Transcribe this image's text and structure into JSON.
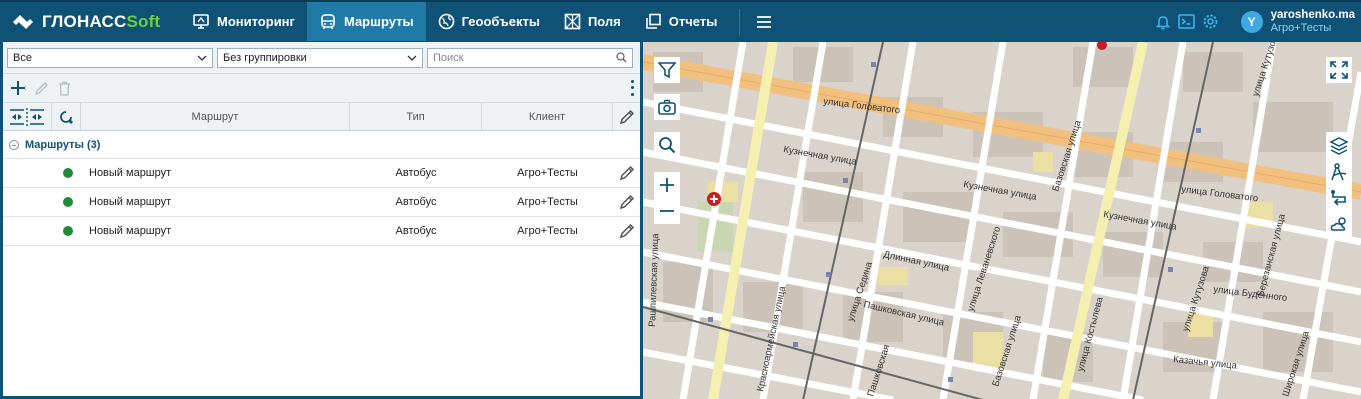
{
  "header": {
    "logo_main": "ГЛОНАСС",
    "logo_soft": "Soft",
    "nav": [
      {
        "label": "Мониторинг",
        "icon": "monitor-icon"
      },
      {
        "label": "Маршруты",
        "icon": "bus-icon",
        "active": true
      },
      {
        "label": "Геообъекты",
        "icon": "globe-icon"
      },
      {
        "label": "Поля",
        "icon": "field-icon"
      },
      {
        "label": "Отчеты",
        "icon": "report-icon"
      }
    ],
    "user": {
      "initial": "Y",
      "name": "yaroshenko.ma",
      "org": "Агро+Тесты"
    }
  },
  "filters": {
    "scope_value": "Все",
    "grouping_value": "Без группировки",
    "search_placeholder": "Поиск"
  },
  "table": {
    "columns": {
      "route": "Маршрут",
      "type": "Тип",
      "client": "Клиент"
    },
    "group_label": "Маршруты (3)",
    "rows": [
      {
        "name": "Новый маршрут",
        "type": "Автобус",
        "client": "Агро+Тесты",
        "status_color": "#1f8a38"
      },
      {
        "name": "Новый маршрут",
        "type": "Автобус",
        "client": "Агро+Тесты",
        "status_color": "#1f8a38"
      },
      {
        "name": "Новый маршрут",
        "type": "Автобус",
        "client": "Агро+Тесты",
        "status_color": "#1f8a38"
      }
    ]
  },
  "map": {
    "streets": {
      "golovatogo_1": "улица Головатого",
      "golovatogo_2": "улица Головатого",
      "kuznechnaya_1": "Кузнечная улица",
      "kuznechnaya_2": "Кузнечная улица",
      "kuznechnaya_3": "Кузнечная улица",
      "dlinnaya": "Длинная улица",
      "pashkovskaya": "Пашковская улица",
      "levanevskogo": "улица Леваневского",
      "kostyleva": "улица Костылева",
      "sedina": "улица Седина",
      "bazovskaya_1": "Базовская улица",
      "bazovskaya_2": "Базовская улица",
      "kazachya": "Казачья улица",
      "budennogo": "улица Будённого",
      "kutuzova": "улица Кутузова",
      "kutuzova_2": "улица Кутузова",
      "rashpilevskaya": "Рашпилевская улица",
      "krasnoarmeyskaya": "Красноармейская улица",
      "bereznyanskaya": "Березанская улица",
      "shirokaya": "Широкая улица",
      "pashkovskaya_2": "Пашковская"
    }
  },
  "colors": {
    "header_bg": "#0f5276",
    "active_tab": "#1f7aa6",
    "accent_green": "#6ccf3c"
  }
}
